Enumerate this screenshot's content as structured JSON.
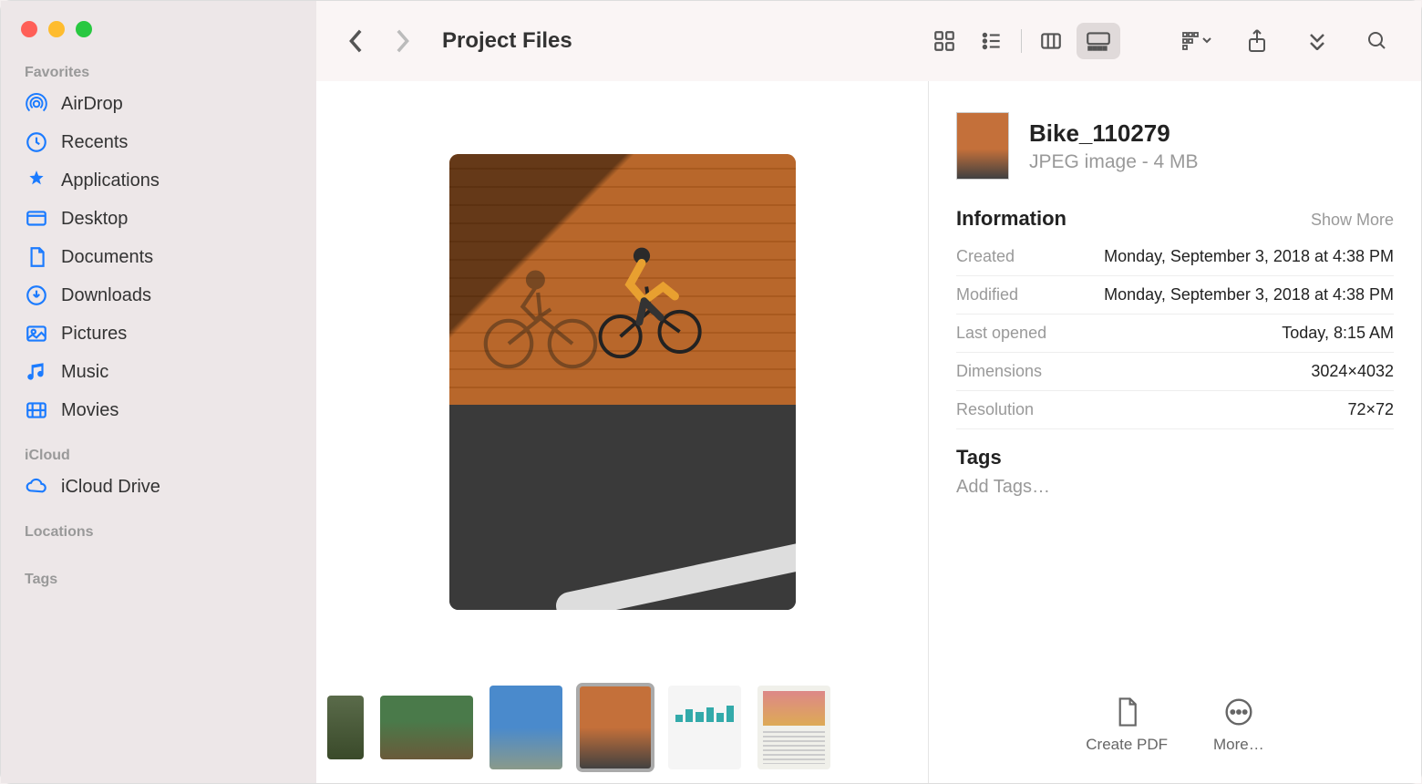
{
  "window": {
    "title": "Project Files"
  },
  "sidebar": {
    "sections": {
      "favorites": {
        "label": "Favorites"
      },
      "icloud": {
        "label": "iCloud"
      },
      "locations": {
        "label": "Locations"
      },
      "tags": {
        "label": "Tags"
      }
    },
    "items": {
      "airdrop": "AirDrop",
      "recents": "Recents",
      "applications": "Applications",
      "desktop": "Desktop",
      "documents": "Documents",
      "downloads": "Downloads",
      "pictures": "Pictures",
      "music": "Music",
      "movies": "Movies",
      "icloud_drive": "iCloud Drive"
    }
  },
  "file": {
    "name": "Bike_110279",
    "subtitle": "JPEG image - 4 MB"
  },
  "info": {
    "section_title": "Information",
    "show_more": "Show More",
    "rows": {
      "created": {
        "key": "Created",
        "value": "Monday, September 3, 2018 at 4:38 PM"
      },
      "modified": {
        "key": "Modified",
        "value": "Monday, September 3, 2018 at 4:38 PM"
      },
      "last_opened": {
        "key": "Last opened",
        "value": "Today, 8:15 AM"
      },
      "dimensions": {
        "key": "Dimensions",
        "value": "3024×4032"
      },
      "resolution": {
        "key": "Resolution",
        "value": "72×72"
      }
    }
  },
  "tags": {
    "title": "Tags",
    "placeholder": "Add Tags…"
  },
  "actions": {
    "create_pdf": "Create PDF",
    "more": "More…"
  }
}
